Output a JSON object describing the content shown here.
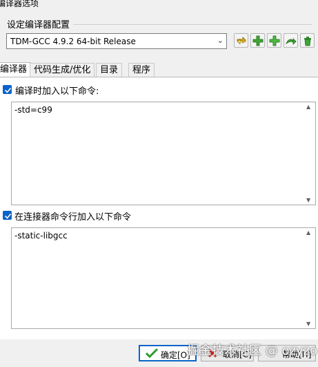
{
  "window": {
    "title": "编译器选项"
  },
  "config_group": {
    "label": "设定编译器配置",
    "selected_compiler": "TDM-GCC 4.9.2 64-bit Release",
    "toolbar": [
      {
        "icon": "swap-arrows-icon"
      },
      {
        "icon": "add-green-icon"
      },
      {
        "icon": "add-green-copy-icon"
      },
      {
        "icon": "rename-arrow-icon"
      },
      {
        "icon": "trash-icon"
      }
    ]
  },
  "tabs": [
    {
      "label": "编译器",
      "active": true
    },
    {
      "label": "代码生成/优化",
      "active": false
    },
    {
      "label": "目录",
      "active": false
    },
    {
      "label": "程序",
      "active": false
    }
  ],
  "compile_section": {
    "checkbox_label": "编译时加入以下命令:",
    "checked": true,
    "commands": "-std=c99"
  },
  "linker_section": {
    "checkbox_label": "在连接器命令行加入以下命令",
    "checked": true,
    "commands": "-static-libgcc"
  },
  "buttons": {
    "ok": "确定[O]",
    "cancel": "取消[C]",
    "help": "帮助[H]"
  },
  "watermark": "掘金技术社区 @ ozyzo",
  "colors": {
    "accent": "#0a63c9",
    "background": "#f0f0f0",
    "add_green": "#3fa535",
    "cancel_red": "#d21b1b"
  }
}
